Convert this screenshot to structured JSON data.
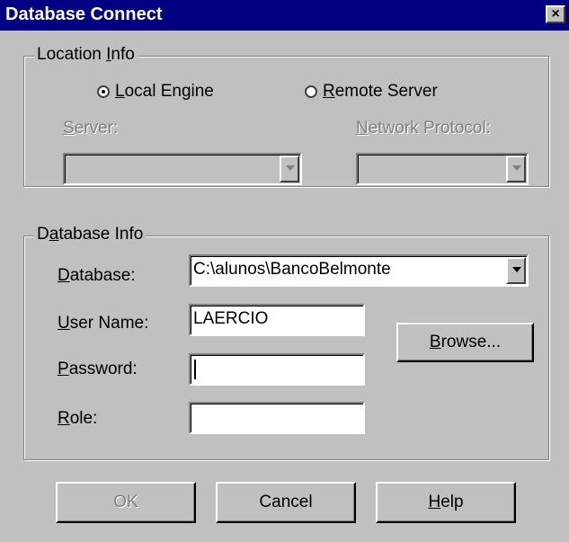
{
  "window": {
    "title": "Database Connect",
    "close_glyph": "×"
  },
  "location": {
    "legend_pre": "Location ",
    "legend_key": "I",
    "legend_post": "nfo",
    "local_key": "L",
    "local_rest": "ocal Engine",
    "local_selected": true,
    "remote_key": "R",
    "remote_rest": "emote Server",
    "remote_selected": false,
    "server_key": "S",
    "server_rest": "erver:",
    "server_value": "",
    "protocol_key": "N",
    "protocol_rest": "etwork Protocol:",
    "protocol_value": ""
  },
  "dbinfo": {
    "legend_pre": "D",
    "legend_key": "a",
    "legend_post": "tabase Info",
    "database_key": "D",
    "database_rest": "atabase:",
    "database_value": "C:\\alunos\\BancoBelmonte",
    "user_key": "U",
    "user_rest": "ser Name:",
    "user_value": "LAERCIO",
    "password_key": "P",
    "password_rest": "assword:",
    "password_value": "",
    "role_key": "R",
    "role_rest": "ole:",
    "role_value": "",
    "browse_key": "B",
    "browse_rest": "rowse..."
  },
  "buttons": {
    "ok": "OK",
    "cancel": "Cancel",
    "help_key": "H",
    "help_rest": "elp"
  }
}
